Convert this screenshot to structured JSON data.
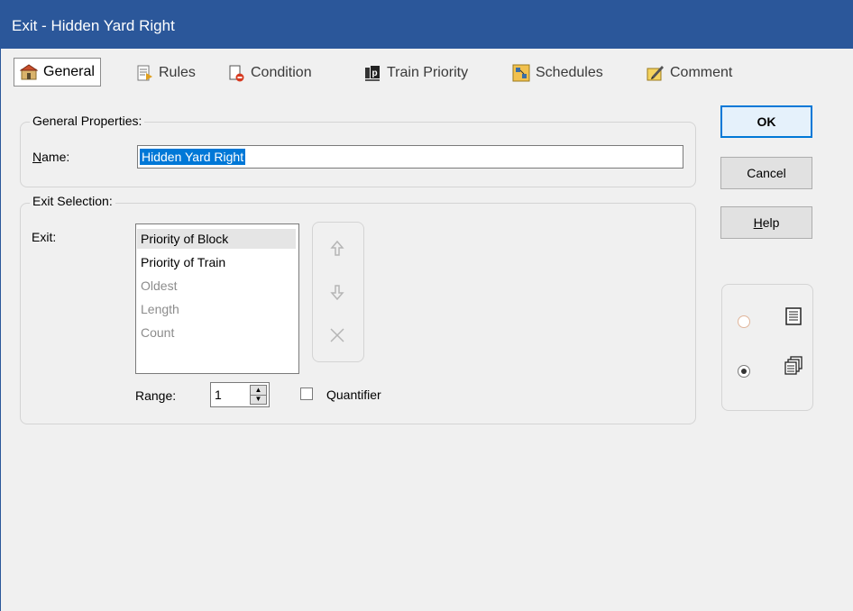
{
  "window": {
    "title": "Exit - Hidden Yard Right"
  },
  "tabs": [
    {
      "label": "General",
      "icon": "general-properties-icon",
      "active": true
    },
    {
      "label": "Rules",
      "icon": "rules-icon"
    },
    {
      "label": "Condition",
      "icon": "condition-icon"
    },
    {
      "label": "Train Priority",
      "icon": "train-priority-icon"
    },
    {
      "label": "Schedules",
      "icon": "schedules-icon"
    },
    {
      "label": "Comment",
      "icon": "comment-icon"
    }
  ],
  "general_properties": {
    "group_label": "General Properties:",
    "name_label": "Name:",
    "name_value": "Hidden Yard Right"
  },
  "exit_selection": {
    "group_label": "Exit Selection:",
    "exit_label": "Exit:",
    "items": [
      {
        "label": "Priority of Block",
        "selected": true,
        "enabled": true
      },
      {
        "label": "Priority of Train",
        "enabled": true
      },
      {
        "label": "Oldest",
        "enabled": false
      },
      {
        "label": "Length",
        "enabled": false
      },
      {
        "label": "Count",
        "enabled": false
      }
    ],
    "range_label": "Range:",
    "range_value": "1",
    "quantifier_label": "Quantifier",
    "quantifier_checked": false
  },
  "buttons": {
    "ok": "OK",
    "cancel": "Cancel",
    "help": "Help"
  },
  "view_options": {
    "list_view_selected": false,
    "multi_view_selected": true
  },
  "colors": {
    "titlebar": "#2b579a",
    "selection": "#0078d7",
    "default_button_border": "#0078d7"
  }
}
